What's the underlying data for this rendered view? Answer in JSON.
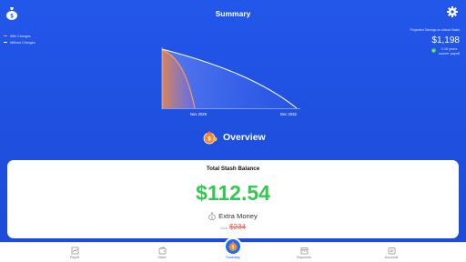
{
  "header": {
    "title": "Summary",
    "left_icon": "money-bag-icon",
    "right_icon": "gear-icon"
  },
  "legend": {
    "with_changes": "With Changes",
    "without_changes": "Without Changes",
    "with_color": "#ff9a4a",
    "without_color": "#ffffff"
  },
  "projection": {
    "label": "Projected Savings on Actual Basis",
    "amount": "$1,198",
    "note_line1": "3.16 years",
    "note_line2": "sooner payoff"
  },
  "chart": {
    "start_label": "Nov 2029",
    "end_label": "Dec 2032"
  },
  "overview": {
    "title": "Overview"
  },
  "card": {
    "title": "Total Stash Balance",
    "balance": "$112.54",
    "extra_label": "Extra Money",
    "goal_label": "Goal",
    "goal_value": "$234"
  },
  "nav": {
    "items": [
      {
        "label": "Payoff",
        "icon": "payoff-icon"
      },
      {
        "label": "Stash",
        "icon": "wallet-icon"
      },
      {
        "label": "Summary",
        "icon": "summary-icon"
      },
      {
        "label": "Payments",
        "icon": "calendar-icon"
      },
      {
        "label": "Accounts",
        "icon": "accounts-icon"
      }
    ]
  },
  "colors": {
    "background": "#1f4fe0",
    "accent_green": "#35c850",
    "goal_red": "#ff5a4a",
    "orange_curve": "#ff9a4a"
  }
}
